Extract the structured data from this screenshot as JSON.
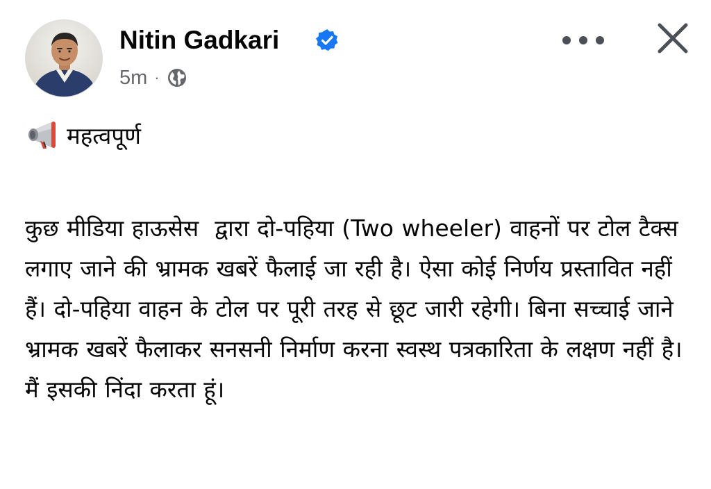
{
  "post": {
    "author": {
      "name": "Nitin Gadkari",
      "verified": true,
      "avatar_icon": "profile-photo"
    },
    "timestamp": "5m",
    "separator": "·",
    "audience_icon": "globe-icon",
    "actions": {
      "more_icon": "more-options-icon",
      "close_icon": "close-icon"
    },
    "tag": {
      "icon": "megaphone-icon",
      "text": "महत्वपूर्ण"
    },
    "body_text": "कुछ मीडिया हाऊसेस  द्वारा दो-पहिया (Two wheeler) वाहनों पर टोल टैक्स लगाए जाने की भ्रामक खबरें फैलाई जा रही है। ऐसा कोई निर्णय प्रस्तावित नहीं हैं। दो-पहिया वाहन के टोल पर पूरी तरह से छूट जारी रहेगी। बिना सच्चाई जाने भ्रामक खबरें फैलाकर सनसनी निर्माण करना स्वस्थ पत्रकारिता के लक्षण नहीं है। मैं इसकी निंदा करता हूं।"
  },
  "colors": {
    "text_primary": "#050505",
    "text_secondary": "#65676b",
    "verified_blue": "#1877f2",
    "background": "#ffffff"
  }
}
